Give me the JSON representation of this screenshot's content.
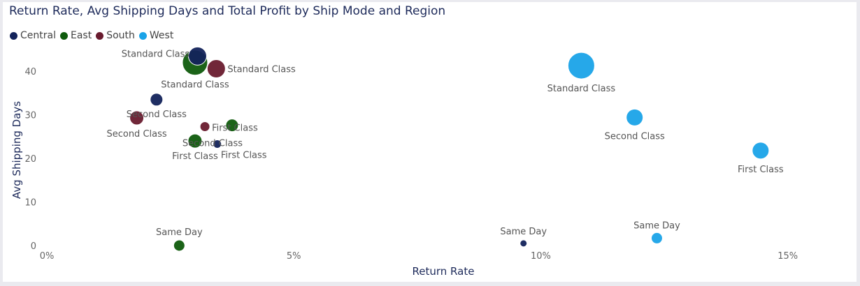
{
  "chart_data": {
    "type": "scatter",
    "title": "Return Rate, Avg Shipping Days and Total Profit by Ship Mode and Region",
    "xlabel": "Return Rate",
    "ylabel": "Avg Shipping Days",
    "xlim": [
      0,
      0.1625
    ],
    "ylim": [
      0,
      45
    ],
    "x_ticks": [
      0,
      0.05,
      0.1,
      0.15
    ],
    "x_tick_labels": [
      "0%",
      "5%",
      "10%",
      "15%"
    ],
    "y_ticks": [
      0,
      10,
      20,
      30,
      40
    ],
    "y_tick_labels": [
      "0",
      "10",
      "20",
      "30",
      "40"
    ],
    "grid": false,
    "legend_position": "top-left",
    "series": [
      {
        "name": "Central",
        "color": "#13235b",
        "points": [
          {
            "label": "Standard Class",
            "x": 0.0305,
            "y": 43.5,
            "size": 13
          },
          {
            "label": "Second Class",
            "x": 0.0222,
            "y": 33.5,
            "size": 9
          },
          {
            "label": "First Class",
            "x": 0.0345,
            "y": 23.3,
            "size": 6
          },
          {
            "label": "Same Day",
            "x": 0.0965,
            "y": 0.5,
            "size": 5
          }
        ]
      },
      {
        "name": "East",
        "color": "#0f5b0c",
        "points": [
          {
            "label": "Standard Class",
            "x": 0.03,
            "y": 42.0,
            "size": 18
          },
          {
            "label": "Second Class",
            "x": 0.0375,
            "y": 27.6,
            "size": 9
          },
          {
            "label": "First Class",
            "x": 0.03,
            "y": 24.0,
            "size": 10
          },
          {
            "label": "Same Day",
            "x": 0.0268,
            "y": 0.0,
            "size": 8
          }
        ]
      },
      {
        "name": "South",
        "color": "#691b2e",
        "points": [
          {
            "label": "Standard Class",
            "x": 0.0343,
            "y": 40.6,
            "size": 13
          },
          {
            "label": "Second Class",
            "x": 0.0182,
            "y": 29.3,
            "size": 10
          },
          {
            "label": "First Class",
            "x": 0.032,
            "y": 27.3,
            "size": 7
          }
        ]
      },
      {
        "name": "West",
        "color": "#1aa3e8",
        "points": [
          {
            "label": "Standard Class",
            "x": 0.1082,
            "y": 41.3,
            "size": 19
          },
          {
            "label": "Second Class",
            "x": 0.119,
            "y": 29.4,
            "size": 12
          },
          {
            "label": "First Class",
            "x": 0.1445,
            "y": 21.8,
            "size": 12
          },
          {
            "label": "Same Day",
            "x": 0.1235,
            "y": 1.7,
            "size": 8
          }
        ]
      }
    ]
  }
}
